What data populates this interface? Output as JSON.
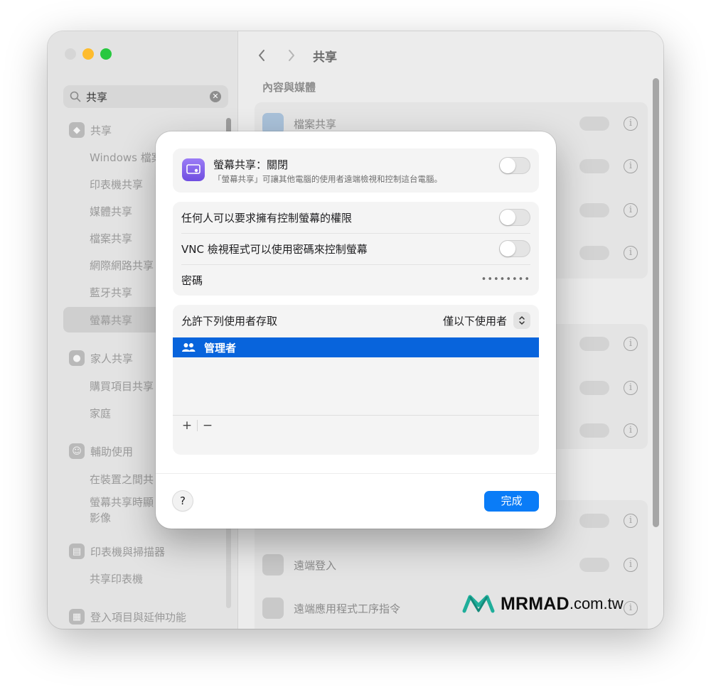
{
  "window": {
    "nav_title": "共享",
    "search": {
      "value": "共享"
    },
    "sidebar": {
      "items": [
        {
          "label": "共享",
          "kind": "head"
        },
        {
          "label": "Windows 檔案共享",
          "kind": "sub"
        },
        {
          "label": "印表機共享",
          "kind": "sub"
        },
        {
          "label": "媒體共享",
          "kind": "sub"
        },
        {
          "label": "檔案共享",
          "kind": "sub"
        },
        {
          "label": "網際網路共享",
          "kind": "sub"
        },
        {
          "label": "藍牙共享",
          "kind": "sub"
        },
        {
          "label": "螢幕共享",
          "kind": "sub",
          "selected": true
        },
        {
          "label": "家人共享",
          "kind": "head"
        },
        {
          "label": "購買項目共享",
          "kind": "sub"
        },
        {
          "label": "家庭",
          "kind": "sub"
        },
        {
          "label": "輔助使用",
          "kind": "head"
        },
        {
          "label": "在裝置之間共",
          "kind": "sub"
        },
        {
          "label": "螢幕共享時顯",
          "kind": "sub"
        },
        {
          "label": "影像",
          "kind": "sub"
        },
        {
          "label": "印表機與掃描器",
          "kind": "head"
        },
        {
          "label": "共享印表機",
          "kind": "sub"
        },
        {
          "label": "登入項目與延伸功能",
          "kind": "head"
        }
      ]
    },
    "main": {
      "section_title": "內容與媒體",
      "rows": [
        {
          "label": "檔案共享"
        },
        {
          "label": "遠端登入"
        },
        {
          "label": "遠端應用程式工序指令"
        }
      ]
    }
  },
  "sheet": {
    "title": "螢幕共享：關閉",
    "description": "「螢幕共享」可讓其他電腦的使用者遠端檢視和控制這台電腦。",
    "main_toggle_on": false,
    "settings": {
      "anyone_label": "任何人可以要求擁有控制螢幕的權限",
      "anyone_on": false,
      "vnc_label": "VNC 檢視程式可以使用密碼來控制螢幕",
      "vnc_on": false,
      "password_label": "密碼",
      "password_value": "••••••••"
    },
    "access": {
      "label": "允許下列使用者存取",
      "selected_option": "僅以下使用者",
      "users": [
        "管理者"
      ],
      "add_label": "+",
      "remove_label": "−"
    },
    "help_label": "?",
    "done_label": "完成"
  },
  "watermark": {
    "brand": "MRMAD",
    "domain": ".com.tw"
  },
  "colors": {
    "accent": "#0a7cf7",
    "selection": "#0864dc",
    "app_icon": "#7b5cf0"
  }
}
